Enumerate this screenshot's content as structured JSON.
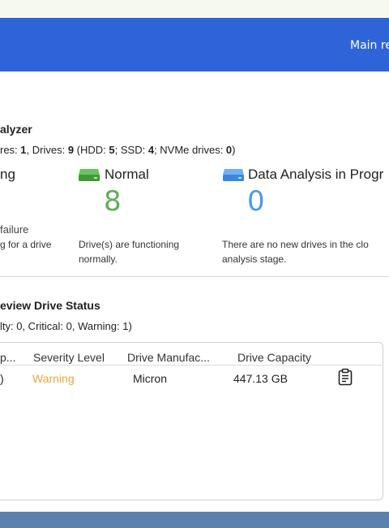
{
  "header": {
    "main_link": "Main re"
  },
  "analyzer": {
    "title": "alyzer",
    "summary": {
      "prefix": "res: ",
      "enclosures": "1",
      "drives_label": ", Drives: ",
      "drives": "9",
      "hdd_label": " (HDD: ",
      "hdd": "5",
      "ssd_label": "; SSD: ",
      "ssd": "4",
      "nvme_label": "; NVMe drives: ",
      "nvme": "0",
      "suffix": ")"
    },
    "warning_card": {
      "title": "ng",
      "label": "failure",
      "desc": "g for a drive"
    },
    "normal_card": {
      "title": "Normal",
      "count": "8",
      "desc": "Drive(s) are functioning normally.",
      "color": "#5fae5a"
    },
    "analysis_card": {
      "title": "Data Analysis in Progr",
      "count": "0",
      "desc": "There are no new drives in the clo analysis stage.",
      "color": "#4b9ae6"
    }
  },
  "review": {
    "title": "eview Drive Status",
    "summary": "lty: 0, Critical: 0, Warning: 1)",
    "columns": [
      "p...",
      "Severity Level",
      "Drive Manufac...",
      "Drive Capacity"
    ],
    "rows": [
      {
        "col0": ")",
        "severity": "Warning",
        "manufacturer": "Micron",
        "capacity": "447.13 GB",
        "action_icon": "clipboard-icon"
      }
    ],
    "warning_color": "#f2a33a"
  },
  "colors": {
    "header": "#2f64d8",
    "footer": "#5b81ad"
  }
}
